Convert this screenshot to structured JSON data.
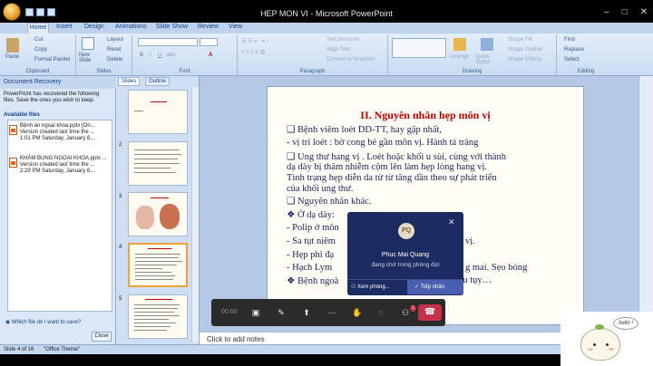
{
  "window": {
    "title": "HEP MON VI - Microsoft PowerPoint"
  },
  "tabs": [
    "Home",
    "Insert",
    "Design",
    "Animations",
    "Slide Show",
    "Review",
    "View"
  ],
  "ribbon": {
    "clipboard": {
      "label": "Clipboard",
      "paste": "Paste",
      "cut": "Cut",
      "copy": "Copy",
      "format_painter": "Format Painter"
    },
    "slides": {
      "label": "Slides",
      "new_slide": "New Slide",
      "layout": "Layout",
      "reset": "Reset",
      "delete": "Delete"
    },
    "font": {
      "label": "Font"
    },
    "paragraph": {
      "label": "Paragraph",
      "text_direction": "Text Direction",
      "align_text": "Align Text",
      "convert_smartart": "Convert to SmartArt"
    },
    "drawing": {
      "label": "Drawing",
      "arrange": "Arrange",
      "quick_styles": "Quick Styles",
      "shape_fill": "Shape Fill",
      "shape_outline": "Shape Outline",
      "shape_effects": "Shape Effects"
    },
    "editing": {
      "label": "Editing",
      "find": "Find",
      "replace": "Replace",
      "select": "Select"
    }
  },
  "recovery": {
    "title": "Document Recovery",
    "message": "PowerPoint has recovered the following files. Save the ones you wish to keep.",
    "available": "Available files",
    "files": [
      {
        "name": "Bệnh án ngoại khoa.pptx [Ori...",
        "line2": "Version created last time the ...",
        "line3": "1:01 PM Saturday, January 8,..."
      },
      {
        "name": "KHÁM BỤNG NGOẠI KHOA.pptx ...",
        "line2": "Version created last time the ...",
        "line3": "2:29 PM Saturday, January 8,..."
      }
    ],
    "help": "Which file do I want to save?",
    "close": "Close"
  },
  "slides_pane": {
    "tab_slides": "Slides",
    "tab_outline": "Outline",
    "numbers": [
      "2",
      "3",
      "4",
      "5"
    ]
  },
  "slide": {
    "title": "II. Nguyên nhân hẹp môn vị",
    "bullets": [
      "❑ Bệnh viêm loét DD-TT,  hay gặp nhất,",
      "-  vị trí loét : bờ cong bé gần môn vị. Hành tá tràng",
      "❑ Ung thư hang vị . Loét hoặc khối u sùi, cùng với thành",
      "   dạ dày bị thâm nhiễm cộm lên làm hẹp lòng hang vị.",
      "   Tình trạng hẹp diễn da từ từ tăng dần theo sự phát triển",
      "   của khối ung thư.",
      "❑ Nguyên nhân khác.",
      "❖ Ở dạ dày:",
      "- Polip ở môn",
      "-  Sa tụt niêm",
      "-  Hẹp phì đạ",
      "-  Hạch Lym",
      "❖ Bệnh ngoà"
    ],
    "fragments": [
      "vị.",
      "g mai. Sẹo bỏng",
      "thư đầu tụy…"
    ]
  },
  "notes": {
    "placeholder": "Click to add notes"
  },
  "status": {
    "slide": "Slide 4 of 16",
    "theme": "\"Office Theme\""
  },
  "call": {
    "timer": "00:00",
    "popup_initials": "PQ",
    "popup_name": "Phuc Mai Quang",
    "popup_status": "đang chờ trong phòng đợi",
    "view_lobby": "Xem phòng...",
    "admit": "Tiếp nhận",
    "badge": "1"
  },
  "sticker": {
    "text": "hello !"
  },
  "colors": {
    "accent": "#c00000",
    "popup_bg": "#1c2c63",
    "hangup": "#c4314b"
  }
}
